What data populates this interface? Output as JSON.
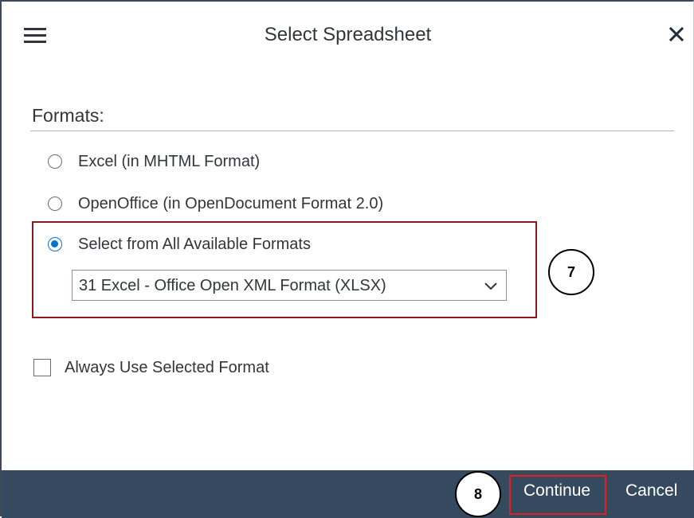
{
  "dialog": {
    "title": "Select Spreadsheet"
  },
  "formats": {
    "label": "Formats:",
    "options": [
      {
        "label": "Excel (in MHTML Format)",
        "checked": false
      },
      {
        "label": "OpenOffice (in OpenDocument Format 2.0)",
        "checked": false
      },
      {
        "label": "Select from All Available Formats",
        "checked": true
      }
    ],
    "select": {
      "value": "31 Excel - Office Open XML Format (XLSX)"
    }
  },
  "always_use": {
    "label": "Always Use Selected Format",
    "checked": false
  },
  "footer": {
    "continue_label": "Continue",
    "cancel_label": "Cancel"
  },
  "callouts": {
    "step7": "7",
    "step8": "8"
  },
  "colors": {
    "footer_bg": "#354a5f",
    "radio_selected": "#0a6ed1",
    "highlight_dark_red": "#8b1a1a",
    "highlight_red": "#e02020"
  },
  "icons": {
    "menu": "menu-icon",
    "close": "close-icon",
    "dropdown": "chevron-down-icon"
  }
}
